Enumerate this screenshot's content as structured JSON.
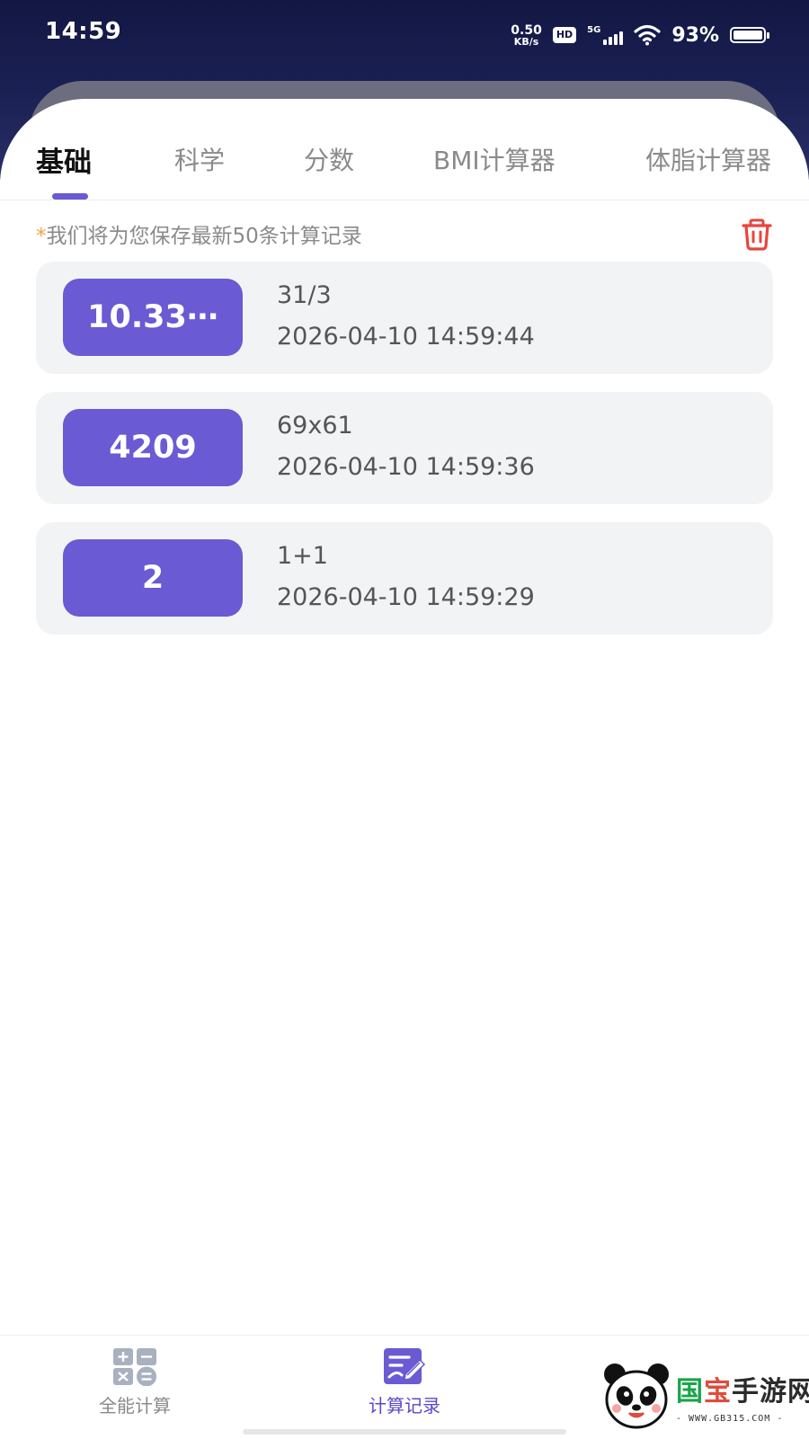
{
  "status_bar": {
    "time": "14:59",
    "net_speed_value": "0.50",
    "net_speed_unit": "KB/s",
    "hd_badge": "HD",
    "signal_label": "5G",
    "battery_percent": "93%"
  },
  "tabs": [
    {
      "label": "基础",
      "active": true
    },
    {
      "label": "科学",
      "active": false
    },
    {
      "label": "分数",
      "active": false
    },
    {
      "label": "BMI计算器",
      "active": false
    },
    {
      "label": "体脂计算器",
      "active": false
    }
  ],
  "notice": {
    "star": "*",
    "text": "我们将为您保存最新50条计算记录"
  },
  "records": [
    {
      "result": "10.33⋯",
      "expression": "31/3",
      "timestamp": "2026-04-10 14:59:44"
    },
    {
      "result": "4209",
      "expression": "69x61",
      "timestamp": "2026-04-10 14:59:36"
    },
    {
      "result": "2",
      "expression": "1+1",
      "timestamp": "2026-04-10 14:59:29"
    }
  ],
  "bottom_nav": [
    {
      "label": "全能计算",
      "icon": "calculator-icon",
      "active": false
    },
    {
      "label": "计算记录",
      "icon": "history-edit-icon",
      "active": true
    }
  ],
  "watermark": {
    "brand": "国宝手游网",
    "url": "- WWW.GB315.COM -"
  },
  "colors": {
    "accent": "#6a5ad3",
    "header_bg": "#121743",
    "card_bg": "#f2f3f5",
    "delete_red": "#e8453c",
    "notice_star": "#f0a34a"
  }
}
